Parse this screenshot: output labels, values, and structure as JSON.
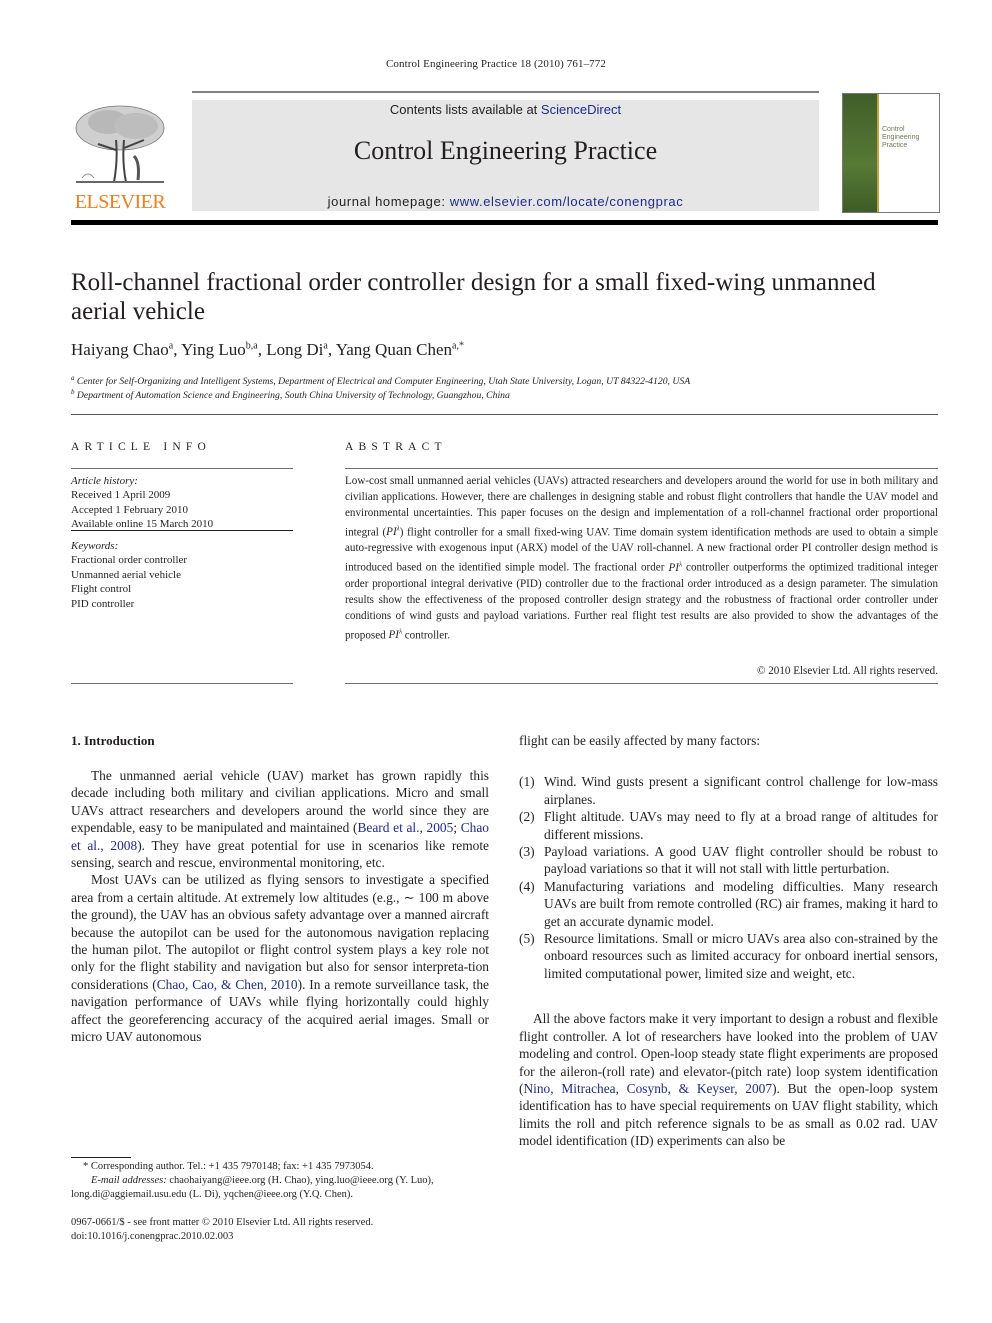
{
  "running_head": "Control Engineering Practice 18 (2010) 761–772",
  "header": {
    "publisher_logo_text": "ELSEVIER",
    "contents_prefix": "Contents lists available at ",
    "contents_link": "ScienceDirect",
    "journal_title": "Control Engineering Practice",
    "homepage_prefix": "journal homepage: ",
    "homepage_link": "www.elsevier.com/locate/conengprac",
    "cover_title": [
      "Control",
      "Engineering",
      "Practice"
    ],
    "colors": {
      "publisher_orange": "#f07f1a",
      "link_blue": "#1f2a8c",
      "header_gray": "#e6e6e6",
      "cover_green": "#4a6b2e"
    }
  },
  "article": {
    "title": "Roll-channel fractional order controller design for a small fixed-wing unmanned aerial vehicle",
    "authors": [
      {
        "name": "Haiyang Chao",
        "sup": "a"
      },
      {
        "name": "Ying Luo",
        "sup": "b,a"
      },
      {
        "name": "Long Di",
        "sup": "a"
      },
      {
        "name": "Yang Quan Chen",
        "sup": "a,*"
      }
    ],
    "affiliations": [
      {
        "sup": "a",
        "text": "Center for Self-Organizing and Intelligent Systems, Department of Electrical and Computer Engineering, Utah State University, Logan, UT 84322-4120, USA"
      },
      {
        "sup": "b",
        "text": "Department of Automation Science and Engineering, South China University of Technology, Guangzhou, China"
      }
    ]
  },
  "article_info": {
    "heading": "ARTICLE INFO",
    "history_label": "Article history:",
    "history": [
      "Received 1 April 2009",
      "Accepted 1 February 2010",
      "Available online 15 March 2010"
    ],
    "keywords_label": "Keywords:",
    "keywords": [
      "Fractional order controller",
      "Unmanned aerial vehicle",
      "Flight control",
      "PID controller"
    ]
  },
  "abstract": {
    "heading": "ABSTRACT",
    "part1": "Low-cost small unmanned aerial vehicles (UAVs) attracted researchers and developers around the world for use in both military and civilian applications. However, there are challenges in designing stable and robust flight controllers that handle the UAV model and environmental uncertainties. This paper focuses on the design and implementation of a roll-channel fractional order proportional integral (",
    "pi_symbol": "PI",
    "lambda": "λ",
    "part2": ") flight controller for a small fixed-wing UAV. Time domain system identification methods are used to obtain a simple auto-regressive with exogenous input (ARX) model of the UAV roll-channel. A new fractional order PI controller design method is introduced based on the identified simple model. The fractional order ",
    "part3": " controller outperforms the optimized traditional integer order proportional integral derivative (PID) controller due to the fractional order introduced as a design parameter. The simulation results show the effectiveness of the proposed controller design strategy and the robustness of fractional order controller under conditions of wind gusts and payload variations. Further real flight test results are also provided to show the advantages of the proposed ",
    "part4": " controller.",
    "copyright": "© 2010 Elsevier Ltd. All rights reserved."
  },
  "body": {
    "section_heading": "1.  Introduction",
    "left_p1_a": "The unmanned aerial vehicle (UAV) market has grown rapidly this decade including both military and civilian applications. Micro and small UAVs attract researchers and developers around the world since they are expendable, easy to be manipulated and maintained (",
    "cite_1": "Beard et al., 2005",
    "cite_sep": "; ",
    "cite_2": "Chao et al., 2008",
    "left_p1_b": "). They have great potential for use in scenarios like remote sensing, search and rescue, environmental monitoring, etc.",
    "left_p2_a": "Most UAVs can be utilized as flying sensors to investigate a specified area from a certain altitude. At extremely low altitudes (e.g., ∼ 100 m above the ground), the UAV has an obvious safety advantage over a manned aircraft because the autopilot can be used for the autonomous navigation replacing the human pilot. The autopilot or flight control system plays a key role not only for the flight stability and navigation but also for sensor interpreta-tion considerations (",
    "cite_3": "Chao, Cao, & Chen, 2010",
    "left_p2_b": "). In a remote surveillance task, the navigation performance of UAVs while flying horizontally could highly affect the georeferencing accuracy of the acquired aerial images. Small or micro UAV autonomous",
    "right_lead": "flight can be easily affected by many factors:",
    "factors": [
      {
        "num": "(1)",
        "text": "Wind. Wind gusts present a significant control challenge for low-mass airplanes."
      },
      {
        "num": "(2)",
        "text": "Flight altitude. UAVs may need to fly at a broad range of altitudes for different missions."
      },
      {
        "num": "(3)",
        "text": "Payload variations. A good UAV flight controller should be robust to payload variations so that it will not stall with little perturbation."
      },
      {
        "num": "(4)",
        "text": "Manufacturing variations and modeling difficulties. Many research UAVs are built from remote controlled (RC) air frames, making it hard to get an accurate dynamic model."
      },
      {
        "num": "(5)",
        "text": "Resource limitations. Small or micro UAVs area also con-strained by the onboard resources such as limited accuracy for onboard inertial sensors, limited computational power, limited size and weight, etc."
      }
    ],
    "right_p_a": "All the above factors make it very important to design a robust and flexible flight controller. A lot of researchers have looked into the problem of UAV modeling and control. Open-loop steady state flight experiments are proposed for the aileron-(roll rate) and elevator-(pitch rate) loop system identification (",
    "cite_4": "Nino, Mitrachea, Cosynb, & Keyser, 2007",
    "right_p_b": "). But the open-loop system identification has to have special requirements on UAV flight stability, which limits the roll and pitch reference signals to be as small as 0.02 rad. UAV model identification (ID) experiments can also be"
  },
  "footnotes": {
    "corresponding": "* Corresponding author. Tel.: +1 435 7970148; fax: +1 435 7973054.",
    "email_label": "E-mail addresses:",
    "emails": " chaohaiyang@ieee.org (H. Chao), ying.luo@ieee.org (Y. Luo), long.di@aggiemail.usu.edu (L. Di), yqchen@ieee.org (Y.Q. Chen).",
    "front_matter": "0967-0661/$ - see front matter © 2010 Elsevier Ltd. All rights reserved.",
    "doi": "doi:10.1016/j.conengprac.2010.02.003"
  }
}
